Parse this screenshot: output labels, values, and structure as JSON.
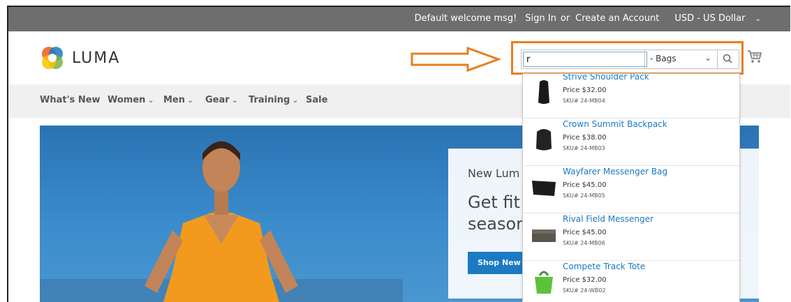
{
  "topbar": {
    "welcome": "Default welcome msg!",
    "sign_in": "Sign In",
    "or": "or",
    "create_account": "Create an Account",
    "currency": "USD - US Dollar"
  },
  "logo": {
    "text": "LUMA"
  },
  "search": {
    "value": "r",
    "category": "- Bags"
  },
  "nav": {
    "items": [
      {
        "label": "What's New",
        "dropdown": false
      },
      {
        "label": "Women",
        "dropdown": true
      },
      {
        "label": "Men",
        "dropdown": true
      },
      {
        "label": "Gear",
        "dropdown": true
      },
      {
        "label": "Training",
        "dropdown": true
      },
      {
        "label": "Sale",
        "dropdown": false
      }
    ]
  },
  "hero": {
    "subtitle": "New Lum",
    "headline_line1": "Get fit",
    "headline_line2": "seasor",
    "button": "Shop New Y"
  },
  "suggestions": [
    {
      "name": "Strive Shoulder Pack",
      "price": "Price $32.00",
      "sku": "SKU# 24-MB04"
    },
    {
      "name": "Crown Summit Backpack",
      "price": "Price $38.00",
      "sku": "SKU# 24-MB03"
    },
    {
      "name": "Wayfarer Messenger Bag",
      "price": "Price $45.00",
      "sku": "SKU# 24-MB05"
    },
    {
      "name": "Rival Field Messenger",
      "price": "Price $45.00",
      "sku": "SKU# 24-MB06"
    },
    {
      "name": "Compete Track Tote",
      "price": "Price $32.00",
      "sku": "SKU# 24-WB02"
    }
  ],
  "colors": {
    "topbar_bg": "#6e6e6e",
    "link_blue": "#1979c3",
    "highlight_orange": "#e67e22",
    "nav_bg": "#f0f0f0"
  }
}
